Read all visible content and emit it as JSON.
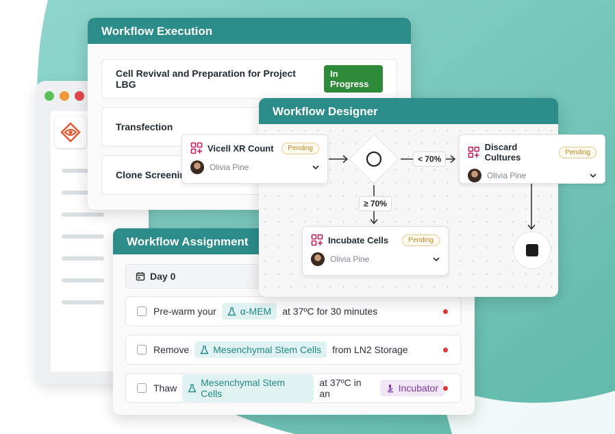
{
  "execution": {
    "title": "Workflow Execution",
    "rows": [
      {
        "name": "Cell Revival and Preparation for Project LBG",
        "status": "In Progress"
      },
      {
        "name": "Transfection"
      },
      {
        "name": "Clone Screenin"
      }
    ]
  },
  "designer": {
    "title": "Workflow Designer",
    "nodes": {
      "vicell": {
        "title": "Vicell XR Count",
        "status": "Pending",
        "user": "Olivia Pine"
      },
      "discard": {
        "title": "Discard Cultures",
        "status": "Pending",
        "user": "Olivia Pine"
      },
      "incubate": {
        "title": "Incubate Cells",
        "status": "Pending",
        "user": "Olivia Pine"
      }
    },
    "edges": {
      "lt": "< 70%",
      "gte": "≥ 70%"
    }
  },
  "assignment": {
    "title": "Workflow Assignment",
    "day": "Day 0",
    "tasks": [
      {
        "pre": "Pre-warm your",
        "chip": "α-MEM",
        "post": "at 37ºC for 30 minutes"
      },
      {
        "pre": "Remove",
        "chip": "Mesenchymal Stem Cells",
        "post": "from LN2 Storage"
      },
      {
        "pre": "Thaw",
        "chip": "Mesenchymal Stem Cells",
        "mid": "at 37ºC in an",
        "chip2": "Incubator"
      }
    ]
  },
  "colors": {
    "header": "#2b8c89",
    "in_progress": "#2e8b3a",
    "pending": "#b98a24",
    "accent_pink": "#c2185b",
    "alert": "#d83c3c"
  },
  "icons": [
    "flask-icon",
    "microscope-icon",
    "calendar-icon",
    "decision-diamond-icon",
    "stop-icon",
    "node-type-icon",
    "chevron-down-icon"
  ]
}
